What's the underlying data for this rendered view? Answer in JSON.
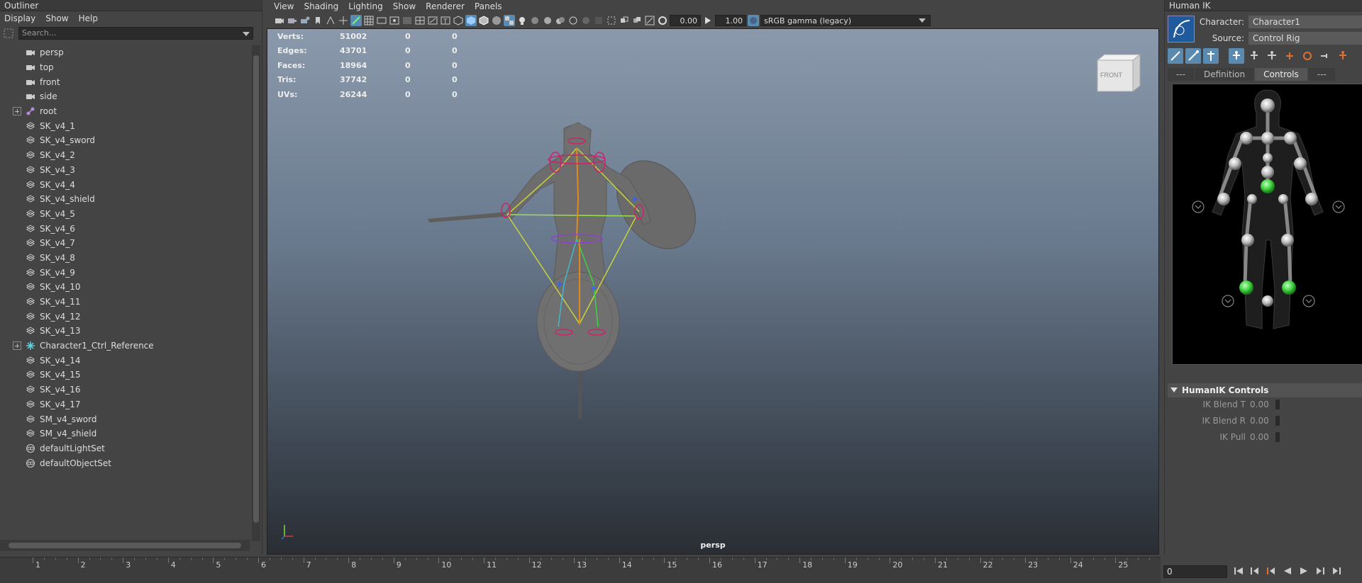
{
  "outliner": {
    "title": "Outliner",
    "menu": [
      "Display",
      "Show",
      "Help"
    ],
    "search_placeholder": "Search...",
    "items": [
      {
        "label": "persp",
        "icon": "camera-icon",
        "expandable": false
      },
      {
        "label": "top",
        "icon": "camera-icon",
        "expandable": false
      },
      {
        "label": "front",
        "icon": "camera-icon",
        "expandable": false
      },
      {
        "label": "side",
        "icon": "camera-icon",
        "expandable": false
      },
      {
        "label": "root",
        "icon": "joint-icon",
        "expandable": true
      },
      {
        "label": "SK_v4_1",
        "icon": "mesh-icon",
        "expandable": false
      },
      {
        "label": "SK_v4_sword",
        "icon": "mesh-icon",
        "expandable": false
      },
      {
        "label": "SK_v4_2",
        "icon": "mesh-icon",
        "expandable": false
      },
      {
        "label": "SK_v4_3",
        "icon": "mesh-icon",
        "expandable": false
      },
      {
        "label": "SK_v4_4",
        "icon": "mesh-icon",
        "expandable": false
      },
      {
        "label": "SK_v4_shield",
        "icon": "mesh-icon",
        "expandable": false
      },
      {
        "label": "SK_v4_5",
        "icon": "mesh-icon",
        "expandable": false
      },
      {
        "label": "SK_v4_6",
        "icon": "mesh-icon",
        "expandable": false
      },
      {
        "label": "SK_v4_7",
        "icon": "mesh-icon",
        "expandable": false
      },
      {
        "label": "SK_v4_8",
        "icon": "mesh-icon",
        "expandable": false
      },
      {
        "label": "SK_v4_9",
        "icon": "mesh-icon",
        "expandable": false
      },
      {
        "label": "SK_v4_10",
        "icon": "mesh-icon",
        "expandable": false
      },
      {
        "label": "SK_v4_11",
        "icon": "mesh-icon",
        "expandable": false
      },
      {
        "label": "SK_v4_12",
        "icon": "mesh-icon",
        "expandable": false
      },
      {
        "label": "SK_v4_13",
        "icon": "mesh-icon",
        "expandable": false
      },
      {
        "label": "Character1_Ctrl_Reference",
        "icon": "hik-reference-icon",
        "expandable": true
      },
      {
        "label": "SK_v4_14",
        "icon": "mesh-icon",
        "expandable": false
      },
      {
        "label": "SK_v4_15",
        "icon": "mesh-icon",
        "expandable": false
      },
      {
        "label": "SK_v4_16",
        "icon": "mesh-icon",
        "expandable": false
      },
      {
        "label": "SK_v4_17",
        "icon": "mesh-icon",
        "expandable": false
      },
      {
        "label": "SM_v4_sword",
        "icon": "mesh-icon",
        "expandable": false
      },
      {
        "label": "SM_v4_shield",
        "icon": "mesh-icon",
        "expandable": false
      },
      {
        "label": "defaultLightSet",
        "icon": "set-icon",
        "expandable": false
      },
      {
        "label": "defaultObjectSet",
        "icon": "set-icon",
        "expandable": false
      }
    ]
  },
  "viewport": {
    "menu": [
      "View",
      "Shading",
      "Lighting",
      "Show",
      "Renderer",
      "Panels"
    ],
    "exposure": "0.00",
    "gamma": "1.00",
    "color_space": "sRGB gamma (legacy)",
    "camera": "persp",
    "view_cube_label": "FRONT",
    "hud": [
      {
        "label": "Verts:",
        "v1": "51002",
        "v2": "0",
        "v3": "0"
      },
      {
        "label": "Edges:",
        "v1": "43701",
        "v2": "0",
        "v3": "0"
      },
      {
        "label": "Faces:",
        "v1": "18964",
        "v2": "0",
        "v3": "0"
      },
      {
        "label": "Tris:",
        "v1": "37742",
        "v2": "0",
        "v3": "0"
      },
      {
        "label": "UVs:",
        "v1": "26244",
        "v2": "0",
        "v3": "0"
      }
    ]
  },
  "hik": {
    "title": "Human IK",
    "character_label": "Character:",
    "character_value": "Character1",
    "source_label": "Source:",
    "source_value": "Control Rig",
    "tabs": [
      "---",
      "Definition",
      "Controls",
      "---"
    ],
    "selected_tab": "Controls",
    "section_title": "HumanIK Controls",
    "sliders": [
      {
        "label": "IK Blend T",
        "value": "0.00"
      },
      {
        "label": "IK Blend R",
        "value": "0.00"
      },
      {
        "label": "IK Pull",
        "value": "0.00"
      }
    ]
  },
  "timeline": {
    "frames": [
      "1",
      "2",
      "3",
      "4",
      "5",
      "6",
      "7",
      "8",
      "9",
      "10",
      "11",
      "12",
      "13",
      "14",
      "15",
      "16",
      "17",
      "18",
      "19",
      "20",
      "21",
      "22",
      "23",
      "24",
      "25"
    ],
    "current_frame": "0"
  },
  "colors": {
    "accent": "#5a8ab0",
    "hik_green": "#3fd23f",
    "joint_orange": "#e08a1e",
    "joint_yellow": "#c8d23a",
    "ring_magenta": "#d0206a"
  }
}
